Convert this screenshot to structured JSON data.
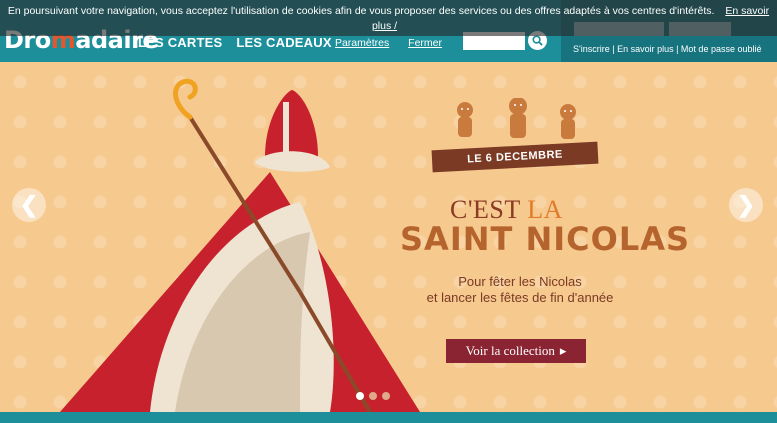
{
  "cookie": {
    "message": "En poursuivant votre navigation, vous acceptez l'utilisation de cookies afin de vous proposer des services ou des offres adaptés à vos centres d'intérêts.",
    "more_link": "En savoir plus /",
    "settings_link": "Paramètres",
    "close_link": "Fermer"
  },
  "header": {
    "logo_prefix": "Dro",
    "logo_o": "m",
    "logo_suffix": "adaire",
    "nav": [
      "LES CARTES",
      "LES CADEAUX"
    ],
    "account_links": "S'inscrire | En savoir plus | Mot de passe oublié"
  },
  "hero": {
    "date_ribbon": "LE 6 DECEMBRE",
    "cest": "C'EST",
    "la": "LA",
    "title": "SAINT NICOLAS",
    "sub_line1": "Pour fêter les Nicolas",
    "sub_line2": "et lancer les fêtes de fin d'année",
    "cta": "Voir la collection",
    "cta_arrow": "▸"
  },
  "icons": {
    "left_arrow": "❮",
    "right_arrow": "❯"
  }
}
